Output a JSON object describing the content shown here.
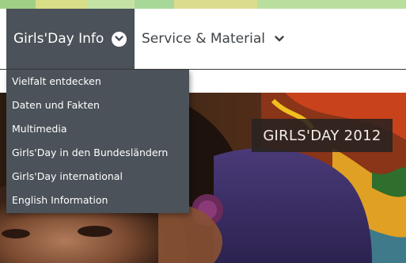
{
  "colors": {
    "stripe": [
      "#9fcf84",
      "#d8dd88",
      "#c4e2a4",
      "#a8d79a",
      "#dcdc8e",
      "#b9df9e"
    ],
    "nav_active_bg": "#4b5259",
    "nav_inactive_text": "#3e4448"
  },
  "nav": {
    "items": [
      {
        "label": "Girls'Day Info",
        "icon": "chevron-down-circle-icon",
        "active": true
      },
      {
        "label": "Service & Material",
        "icon": "chevron-down-icon",
        "active": false
      }
    ]
  },
  "dropdown": {
    "items": [
      "Vielfalt entdecken",
      "Daten und Fakten",
      "Multimedia",
      "Girls'Day in den Bundesländern",
      "Girls'Day international",
      "English Information"
    ]
  },
  "hero": {
    "badge": "GIRLS'DAY 2012"
  }
}
